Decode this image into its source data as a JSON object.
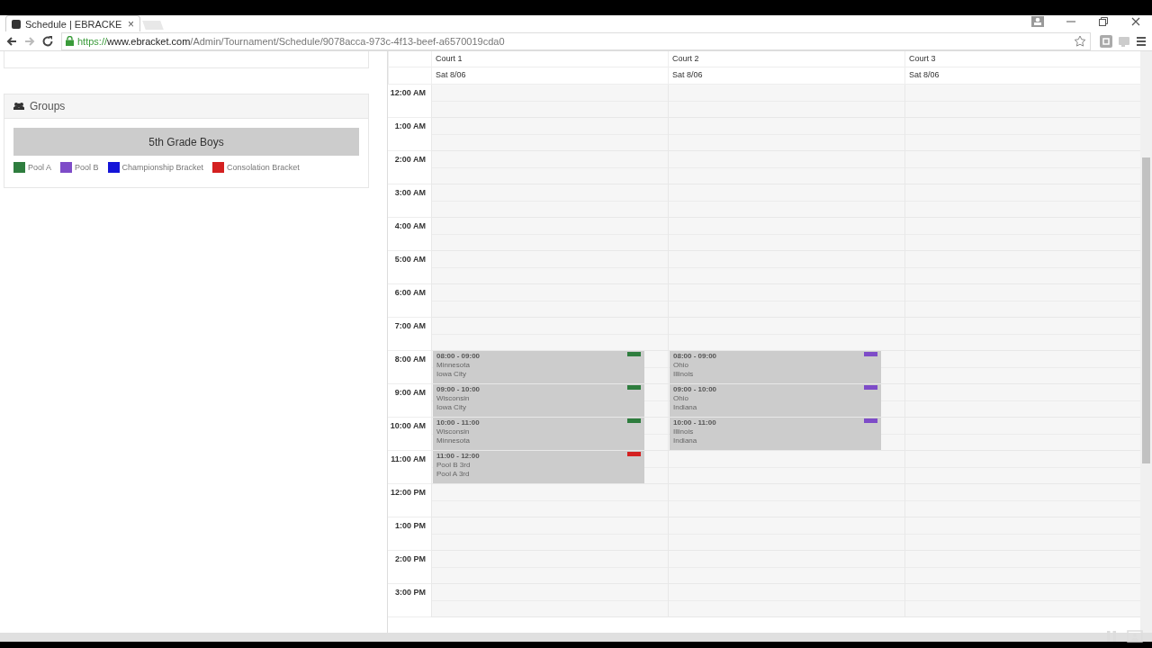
{
  "browser": {
    "tab_title": "Schedule | EBRACKE",
    "tab_close": "×",
    "url_scheme": "https://",
    "url_domain": "www.ebracket.com",
    "url_path": "/Admin/Tournament/Schedule/9078acca-973c-4f13-beef-a6570019cda0"
  },
  "groups_panel": {
    "title": "Groups",
    "group_button": "5th Grade Boys",
    "legend": [
      {
        "label": "Pool A",
        "color": "#2e7d3e"
      },
      {
        "label": "Pool B",
        "color": "#7e4cc8"
      },
      {
        "label": "Championship Bracket",
        "color": "#1414d8"
      },
      {
        "label": "Consolation Bracket",
        "color": "#d42020"
      }
    ]
  },
  "calendar": {
    "courts": [
      {
        "name": "Court 1",
        "date": "Sat 8/06"
      },
      {
        "name": "Court 2",
        "date": "Sat 8/06"
      },
      {
        "name": "Court 3",
        "date": "Sat 8/06"
      }
    ],
    "hours": [
      {
        "label": "12:00 AM"
      },
      {
        "label": "1:00 AM"
      },
      {
        "label": "2:00 AM"
      },
      {
        "label": "3:00 AM"
      },
      {
        "label": "4:00 AM"
      },
      {
        "label": "5:00 AM"
      },
      {
        "label": "6:00 AM"
      },
      {
        "label": "7:00 AM"
      },
      {
        "label": "8:00 AM",
        "games": [
          {
            "time": "08:00 - 09:00",
            "team1": "Minnesota",
            "team2": "Iowa City",
            "color": "#2e7d3e"
          },
          {
            "time": "08:00 - 09:00",
            "team1": "Ohio",
            "team2": "Illinois",
            "color": "#7e4cc8"
          }
        ]
      },
      {
        "label": "9:00 AM",
        "games": [
          {
            "time": "09:00 - 10:00",
            "team1": "Wisconsin",
            "team2": "Iowa City",
            "color": "#2e7d3e"
          },
          {
            "time": "09:00 - 10:00",
            "team1": "Ohio",
            "team2": "Indiana",
            "color": "#7e4cc8"
          }
        ]
      },
      {
        "label": "10:00 AM",
        "games": [
          {
            "time": "10:00 - 11:00",
            "team1": "Wisconsin",
            "team2": "Minnesota",
            "color": "#2e7d3e"
          },
          {
            "time": "10:00 - 11:00",
            "team1": "Illinois",
            "team2": "Indiana",
            "color": "#7e4cc8"
          }
        ]
      },
      {
        "label": "11:00 AM",
        "games": [
          {
            "time": "11:00 - 12:00",
            "team1": "Pool B 3rd",
            "team2": "Pool A 3rd",
            "color": "#d42020"
          }
        ]
      },
      {
        "label": "12:00 PM"
      },
      {
        "label": "1:00 PM"
      },
      {
        "label": "2:00 PM"
      },
      {
        "label": "3:00 PM"
      }
    ]
  }
}
